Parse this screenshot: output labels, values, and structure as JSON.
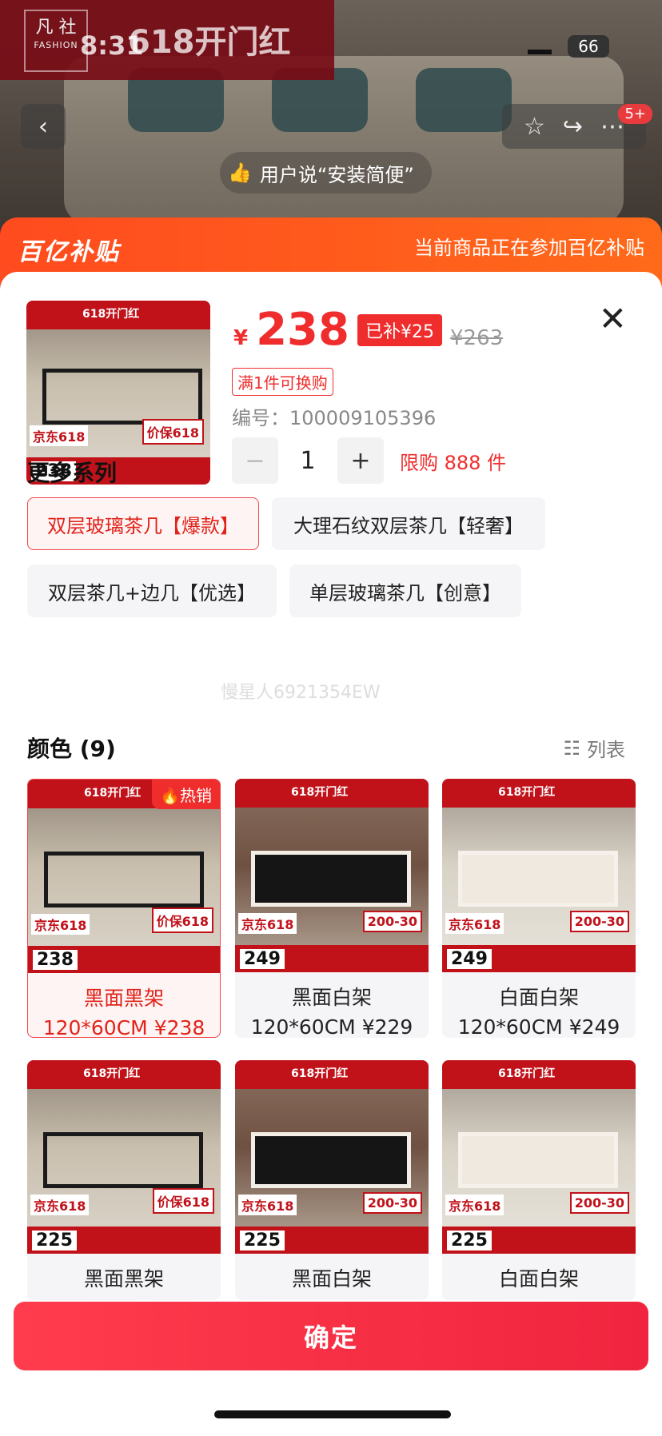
{
  "header": {
    "brand_cn": "凡 社",
    "brand_en": "FASHION",
    "promo": "618开门红",
    "time": "8:31",
    "battery": "66",
    "cart_count": "5+",
    "user_says": "用户说“安装简便”"
  },
  "subsidy": {
    "logo": "百亿补贴",
    "note": "当前商品正在参加百亿补贴"
  },
  "product": {
    "currency": "¥",
    "price": "238",
    "subsidy_tag": "已补¥25",
    "original_price": "¥263",
    "swap_tag": "满1件可换购",
    "sku_label": "编号：100009105396",
    "quantity": "1",
    "minus_label": "−",
    "plus_label": "+",
    "limit": "限购 888 件",
    "thumb_price": "238"
  },
  "series": {
    "title": "更多系列",
    "options": [
      "双层玻璃茶几【爆款】",
      "大理石纹双层茶几【轻奢】",
      "双层茶几+边几【优选】",
      "单层玻璃茶几【创意】"
    ]
  },
  "watermark": "慢星人6921354EW",
  "colors": {
    "title": "颜色 (9)",
    "list_toggle": "列表",
    "hot_label": "热销",
    "items": [
      {
        "name": "黑面黑架",
        "spec": "120*60CM ¥238",
        "img_price": "238",
        "frame": "dark",
        "badge": "价保618"
      },
      {
        "name": "黑面白架",
        "spec": "120*60CM ¥229",
        "img_price": "249",
        "frame": "white",
        "badge": "200-30"
      },
      {
        "name": "白面白架",
        "spec": "120*60CM ¥249",
        "img_price": "249",
        "frame": "light",
        "badge": "200-30"
      },
      {
        "name": "黑面黑架",
        "spec": "",
        "img_price": "225",
        "frame": "dark",
        "badge": "价保618"
      },
      {
        "name": "黑面白架",
        "spec": "",
        "img_price": "225",
        "frame": "white",
        "badge": "200-30"
      },
      {
        "name": "白面白架",
        "spec": "",
        "img_price": "225",
        "frame": "light",
        "badge": "200-30"
      }
    ]
  },
  "footer": {
    "confirm": "确定"
  },
  "colors_palette": {
    "accent": "#f02d2d",
    "subsidy": "#ff5a1f"
  }
}
